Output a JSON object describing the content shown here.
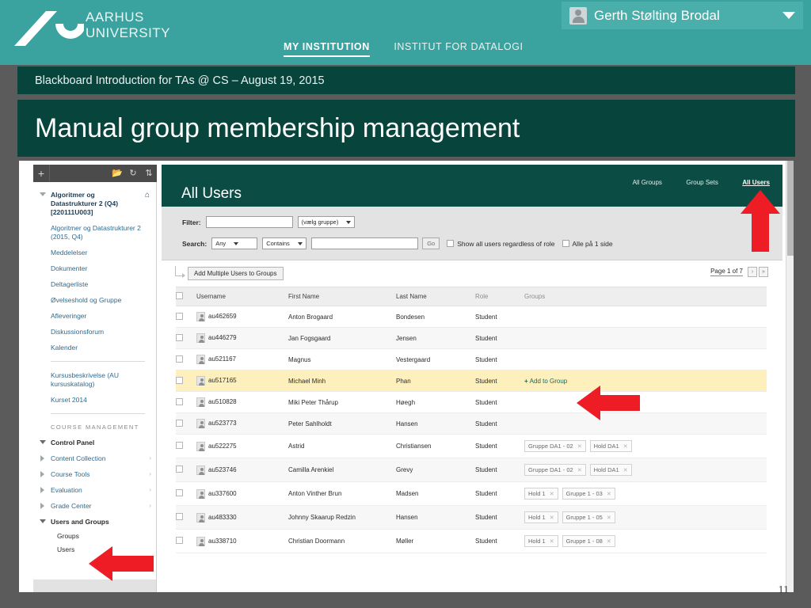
{
  "au_header": {
    "wordmark_line1": "AARHUS",
    "wordmark_line2": "UNIVERSITY",
    "nav": [
      {
        "label": "MY INSTITUTION",
        "active": true
      },
      {
        "label": "INSTITUT FOR DATALOGI",
        "active": false
      }
    ],
    "user": {
      "name": "Gerth Stølting Brodal"
    }
  },
  "slide": {
    "subtitle": "Blackboard Introduction for TAs @ CS – August 19, 2015",
    "title": "Manual group membership management",
    "number": "11"
  },
  "course_menu": {
    "toolbar_icons": [
      "plus",
      "folder",
      "refresh",
      "sort"
    ],
    "course_title": "Algoritmer og Datastrukturer 2 (Q4) [220111U003]",
    "links": [
      "Algoritmer og Datastrukturer 2 (2015, Q4)",
      "Meddelelser",
      "Dokumenter",
      "Deltagerliste",
      "Øvelseshold og Gruppe",
      "Afleveringer",
      "Diskussionsforum",
      "Kalender"
    ],
    "links2": [
      "Kursusbeskrivelse (AU kursuskatalog)",
      "Kurset 2014"
    ],
    "section_label": "COURSE MANAGEMENT",
    "management": [
      {
        "label": "Control Panel",
        "bold": true,
        "expanded": true,
        "chevron": false
      },
      {
        "label": "Content Collection",
        "bold": false,
        "expanded": false,
        "chevron": true
      },
      {
        "label": "Course Tools",
        "bold": false,
        "expanded": false,
        "chevron": true
      },
      {
        "label": "Evaluation",
        "bold": false,
        "expanded": false,
        "chevron": true
      },
      {
        "label": "Grade Center",
        "bold": false,
        "expanded": false,
        "chevron": true
      },
      {
        "label": "Users and Groups",
        "bold": true,
        "expanded": true,
        "chevron": false
      }
    ],
    "sub_items": [
      "Groups",
      "Users"
    ]
  },
  "bb": {
    "tabs": [
      {
        "label": "All Groups",
        "active": false
      },
      {
        "label": "Group Sets",
        "active": false
      },
      {
        "label": "All Users",
        "active": true
      }
    ],
    "page_title": "All Users",
    "filter": {
      "label": "Filter:",
      "text_value": "",
      "group_select": "(vælg gruppe)"
    },
    "search": {
      "label": "Search:",
      "field_select": "Any",
      "op_select": "Contains",
      "text_value": "",
      "go_label": "Go",
      "checkbox_1": "Show all users regardless of role",
      "checkbox_2": "Alle på 1 side"
    },
    "action_button": "Add Multiple Users to Groups",
    "pager": {
      "text": "Page 1 of 7",
      "next": "›",
      "last": "»"
    },
    "columns": [
      "Username",
      "First Name",
      "Last Name",
      "Role",
      "Groups"
    ],
    "rows": [
      {
        "username": "au462659",
        "first": "Anton Brogaard",
        "last": "Bondesen",
        "role": "Student",
        "groups": [],
        "add_link": "",
        "highlight": false
      },
      {
        "username": "au446279",
        "first": "Jan Fogsgaard",
        "last": "Jensen",
        "role": "Student",
        "groups": [],
        "add_link": "",
        "highlight": false
      },
      {
        "username": "au521167",
        "first": "Magnus",
        "last": "Vestergaard",
        "role": "Student",
        "groups": [],
        "add_link": "",
        "highlight": false
      },
      {
        "username": "au517165",
        "first": "Michael Minh",
        "last": "Phan",
        "role": "Student",
        "groups": [],
        "add_link": "Add to Group",
        "highlight": true
      },
      {
        "username": "au510828",
        "first": "Miki Peter Thårup",
        "last": "Høegh",
        "role": "Student",
        "groups": [],
        "add_link": "",
        "highlight": false
      },
      {
        "username": "au523773",
        "first": "Peter Sahlholdt",
        "last": "Hansen",
        "role": "Student",
        "groups": [],
        "add_link": "",
        "highlight": false
      },
      {
        "username": "au522275",
        "first": "Astrid",
        "last": "Christiansen",
        "role": "Student",
        "groups": [
          "Gruppe DA1 - 02",
          "Hold DA1"
        ],
        "add_link": "",
        "highlight": false
      },
      {
        "username": "au523746",
        "first": "Camilla Arenkiel",
        "last": "Grevy",
        "role": "Student",
        "groups": [
          "Gruppe DA1 - 02",
          "Hold DA1"
        ],
        "add_link": "",
        "highlight": false
      },
      {
        "username": "au337600",
        "first": "Anton Vinther Brun",
        "last": "Madsen",
        "role": "Student",
        "groups": [
          "Hold 1",
          "Gruppe 1 - 03"
        ],
        "add_link": "",
        "highlight": false
      },
      {
        "username": "au483330",
        "first": "Johnny Skaarup Redzin",
        "last": "Hansen",
        "role": "Student",
        "groups": [
          "Hold 1",
          "Gruppe 1 - 05"
        ],
        "add_link": "",
        "highlight": false
      },
      {
        "username": "au338710",
        "first": "Christian Doormann",
        "last": "Møller",
        "role": "Student",
        "groups": [
          "Hold 1",
          "Gruppe 1 - 08"
        ],
        "add_link": "",
        "highlight": false
      }
    ]
  },
  "colors": {
    "au_teal": "#3aa3a0",
    "dark_green": "#07443c",
    "bb_header_green": "#0b4d45",
    "arrow_red": "#ee1c25",
    "highlight_yellow": "#fdf0bc",
    "link_blue": "#2f6b8f"
  }
}
